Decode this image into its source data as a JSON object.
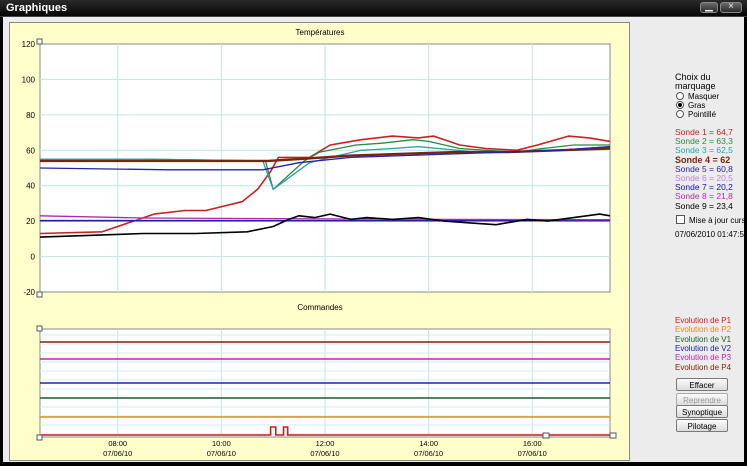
{
  "window": {
    "title": "Graphiques",
    "close_glyph": "×"
  },
  "charts": {
    "temps_title": "Températures",
    "commands_title": "Commandes"
  },
  "chart_data": [
    {
      "type": "line",
      "title": "Températures",
      "ylim": [
        -20,
        120
      ],
      "yticks": [
        "120",
        "100",
        "80",
        "60",
        "40",
        "20",
        "0",
        "-20"
      ],
      "xlim": [
        "07/06/10 06:30",
        "07/06/10 17:30"
      ],
      "grid": true,
      "series": [
        {
          "name": "Sonde 1",
          "color": "#cc2020",
          "x": [
            0,
            1.2,
            2.2,
            2.8,
            3.2,
            3.9,
            4.2,
            4.45,
            4.6,
            5.2,
            5.6,
            6.2,
            6.8,
            7.3,
            7.6,
            8.1,
            8.6,
            9.2,
            9.6,
            10.2,
            10.6,
            11
          ],
          "y": [
            13,
            14,
            24,
            26,
            26,
            31,
            38,
            48,
            56,
            56,
            63,
            66,
            68,
            67,
            68,
            63,
            61,
            60,
            63,
            68,
            67,
            65
          ]
        },
        {
          "name": "Sonde 2",
          "color": "#2a8a44",
          "x": [
            0,
            2,
            4.35,
            4.5,
            5.1,
            5.4,
            6.1,
            6.6,
            7.2,
            7.5,
            8.1,
            8.6,
            9.2,
            9.7,
            10.3,
            11
          ],
          "y": [
            55,
            55,
            54,
            38,
            54,
            59,
            63,
            64,
            66,
            65,
            61,
            60,
            59,
            61,
            63,
            63
          ]
        },
        {
          "name": "Sonde 3",
          "color": "#2ea0a6",
          "x": [
            0,
            2,
            4.3,
            4.5,
            5.2,
            5.6,
            6.2,
            6.8,
            7.3,
            7.7,
            8.4,
            9.2,
            10,
            11
          ],
          "y": [
            55,
            55,
            54,
            38,
            53,
            56,
            60,
            61,
            62,
            61,
            59,
            59,
            60,
            62
          ]
        },
        {
          "name": "Sonde 4",
          "color": "#7a2410",
          "x": [
            0,
            3,
            4.4,
            5,
            6,
            7,
            8,
            9,
            10,
            11
          ],
          "y": [
            54,
            54,
            54,
            55,
            57,
            58,
            59,
            59,
            60,
            61
          ]
        },
        {
          "name": "Sonde 5",
          "color": "#2424a8",
          "x": [
            0,
            2.5,
            4.3,
            5,
            6,
            7,
            8,
            9,
            10,
            11
          ],
          "y": [
            50,
            49,
            49,
            53,
            56,
            57,
            58,
            59,
            60,
            62
          ]
        },
        {
          "name": "Sonde 6",
          "color": "#c080e0",
          "x": [
            0,
            11
          ],
          "y": [
            20.5,
            20.5
          ]
        },
        {
          "name": "Sonde 7",
          "color": "#1010a8",
          "x": [
            0,
            11
          ],
          "y": [
            20.2,
            20.2
          ]
        },
        {
          "name": "Sonde 8",
          "color": "#b02ab0",
          "x": [
            0,
            2,
            4,
            6,
            8,
            11
          ],
          "y": [
            23,
            21.8,
            21.5,
            21.2,
            21,
            20.8
          ]
        },
        {
          "name": "Sonde 9",
          "color": "#000000",
          "x": [
            0,
            1,
            2,
            3,
            4,
            4.5,
            4.8,
            5,
            5.3,
            5.6,
            6,
            6.3,
            6.8,
            7.3,
            7.8,
            8.3,
            8.8,
            9.4,
            9.8,
            10.3,
            10.8,
            11
          ],
          "y": [
            11,
            12,
            13,
            13,
            14,
            17,
            21,
            23,
            22,
            24,
            21,
            22,
            21,
            22,
            20,
            19,
            18,
            21,
            20,
            22,
            24,
            23
          ]
        }
      ]
    },
    {
      "type": "line",
      "title": "Commandes",
      "xlim": [
        "07/06/10 06:30",
        "07/06/10 17:30"
      ],
      "x_ticks": [
        {
          "time": "08:00",
          "date": "07/06/10"
        },
        {
          "time": "10:00",
          "date": "07/06/10"
        },
        {
          "time": "12:00",
          "date": "07/06/10"
        },
        {
          "time": "14:00",
          "date": "07/06/10"
        },
        {
          "time": "16:00",
          "date": "07/06/10"
        }
      ],
      "series": [
        {
          "name": "Evolution de P1",
          "color": "#cc2020",
          "level": 0
        },
        {
          "name": "Evolution de P2",
          "color": "#e0900a",
          "level": 0.18
        },
        {
          "name": "Evolution de V1",
          "color": "#1a5a2a",
          "level": 0.37
        },
        {
          "name": "Evolution de V2",
          "color": "#2020a0",
          "level": 0.52
        },
        {
          "name": "Evolution de P3",
          "color": "#c020c0",
          "level": 0.76
        },
        {
          "name": "Evolution de P4",
          "color": "#7a2410",
          "level": 0.93
        }
      ]
    }
  ],
  "marker": {
    "title_line1": "Choix du",
    "title_line2": "marquage",
    "options": [
      "Masquer",
      "Gras",
      "Pointillé"
    ],
    "selected": "Gras"
  },
  "sondes": [
    {
      "label": "Sonde 1 = 64,7",
      "color": "#cc2020"
    },
    {
      "label": "Sonde 2 = 63,3",
      "color": "#2a8a44"
    },
    {
      "label": "Sonde 3 = 62,5",
      "color": "#2ea0a6"
    },
    {
      "label": "Sonde 4 = 62",
      "color": "#7a2410",
      "bold": true
    },
    {
      "label": "Sonde 5 = 60,8",
      "color": "#2424a8"
    },
    {
      "label": "Sonde 6 = 20,5",
      "color": "#c080e0"
    },
    {
      "label": "Sonde 7 = 20,2",
      "color": "#1010a8"
    },
    {
      "label": "Sonde 8 = 21,8",
      "color": "#b02ab0"
    },
    {
      "label": "Sonde 9 = 23,4",
      "color": "#000000"
    }
  ],
  "cursor": {
    "label": "Mise à jour curseur",
    "checked": false,
    "timestamp": "07/06/2010 01:47:55"
  },
  "evolutions": [
    {
      "label": "Evolution de P1",
      "color": "#cc2020"
    },
    {
      "label": "Evolution de P2",
      "color": "#e0900a"
    },
    {
      "label": "Evolution de V1",
      "color": "#1a5a2a"
    },
    {
      "label": "Evolution de V2",
      "color": "#2020a0"
    },
    {
      "label": "Evolution de P3",
      "color": "#c020c0"
    },
    {
      "label": "Evolution de P4",
      "color": "#7a2410"
    }
  ],
  "buttons": {
    "effacer": "Effacer",
    "reprendre": "Reprendre",
    "synoptique": "Synoptique",
    "pilotage": "Pilotage"
  }
}
